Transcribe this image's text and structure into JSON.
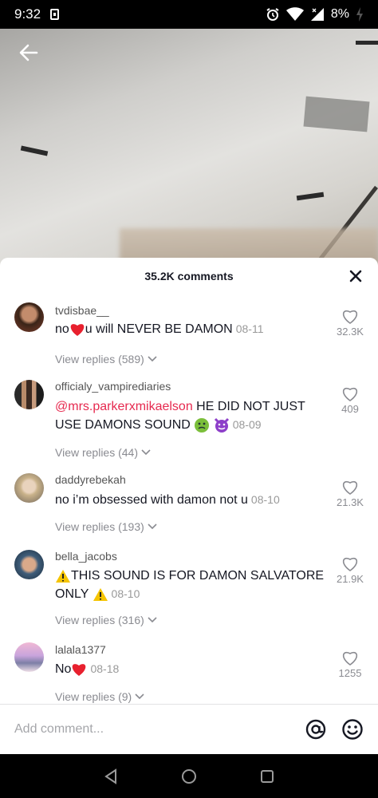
{
  "status_bar": {
    "time": "9:32",
    "battery_pct": "8%"
  },
  "sheet": {
    "title": "35.2K comments",
    "close_label": "close"
  },
  "comments": [
    {
      "username": "tvdisbae__",
      "text_before": "no",
      "text_after": "u will NEVER BE DAMON",
      "date": "08-11",
      "replies": "View replies (589)",
      "likes": "32.3K",
      "emoji": [
        "red-heart"
      ]
    },
    {
      "username": "officialy_vampirediaries",
      "mention": "@mrs.parkerxmikaelson",
      "text_after": " HE DID NOT JUST USE DAMONS SOUND",
      "date": "08-09",
      "replies": "View replies (44)",
      "likes": "409",
      "emoji": [
        "nauseated-face",
        "smiling-face-with-horns"
      ]
    },
    {
      "username": "daddyrebekah",
      "text": "no i’m obsessed with damon not u",
      "date": "08-10",
      "replies": "View replies (193)",
      "likes": "21.3K"
    },
    {
      "username": "bella_jacobs",
      "text_before": "THIS SOUND IS FOR DAMON SALVATORE ONLY",
      "date": "08-10",
      "replies": "View replies (316)",
      "likes": "21.9K",
      "emoji": [
        "warning-sign",
        "warning-sign"
      ]
    },
    {
      "username": "lalala1377",
      "text_before": "No",
      "date": "08-18",
      "replies": "View replies (9)",
      "likes": "1255",
      "emoji": [
        "red-heart"
      ]
    }
  ],
  "add_comment": {
    "placeholder": "Add comment..."
  },
  "colors": {
    "mention": "#e6294f",
    "heart": "#e8202e",
    "warning": "#f5c400",
    "sheet_bg": "#ffffff"
  }
}
